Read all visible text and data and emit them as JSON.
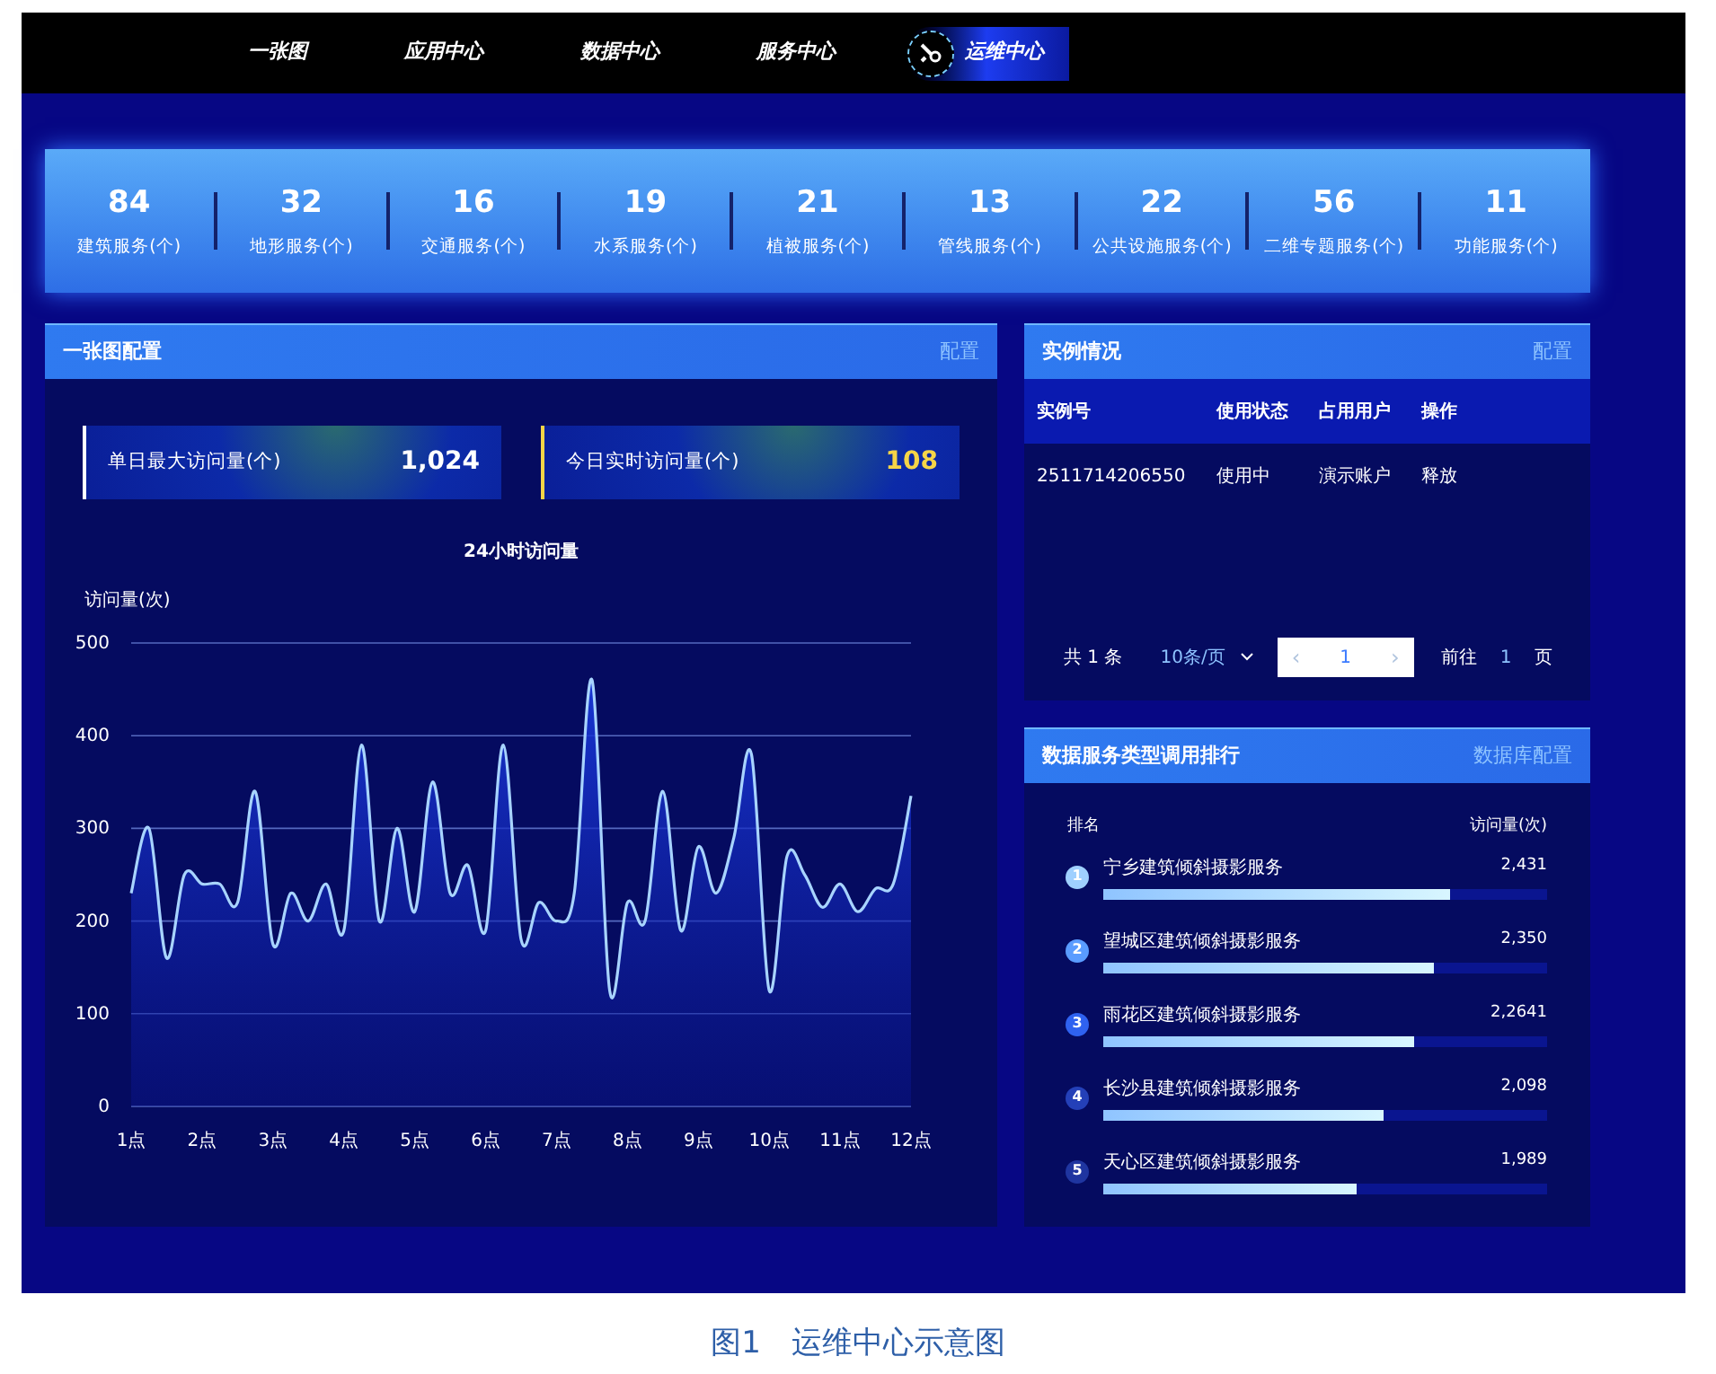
{
  "nav": {
    "tabs": [
      {
        "label": "一张图",
        "selected": false
      },
      {
        "label": "应用中心",
        "selected": false
      },
      {
        "label": "数据中心",
        "selected": false
      },
      {
        "label": "服务中心",
        "selected": false
      },
      {
        "label": "运维中心",
        "selected": true
      }
    ]
  },
  "stats": [
    {
      "value": "84",
      "label": "建筑服务(个)"
    },
    {
      "value": "32",
      "label": "地形服务(个)"
    },
    {
      "value": "16",
      "label": "交通服务(个)"
    },
    {
      "value": "19",
      "label": "水系服务(个)"
    },
    {
      "value": "21",
      "label": "植被服务(个)"
    },
    {
      "value": "13",
      "label": "管线服务(个)"
    },
    {
      "value": "22",
      "label": "公共设施服务(个)"
    },
    {
      "value": "56",
      "label": "二维专题服务(个)"
    },
    {
      "value": "11",
      "label": "功能服务(个)"
    }
  ],
  "map_panel": {
    "title": "一张图配置",
    "action": "配置",
    "kpis": [
      {
        "label": "单日最大访问量(个)",
        "value": "1,024",
        "color": "#ffffff"
      },
      {
        "label": "今日实时访问量(个)",
        "value": "108",
        "color": "#f5d547"
      }
    ],
    "chart_data": {
      "type": "area",
      "title": "24小时访问量",
      "ylabel": "访问量(次)",
      "x": [
        1,
        1.25,
        1.5,
        1.75,
        2,
        2.25,
        2.5,
        2.75,
        3,
        3.25,
        3.5,
        3.75,
        4,
        4.25,
        4.5,
        4.75,
        5,
        5.25,
        5.5,
        5.75,
        6,
        6.25,
        6.5,
        6.75,
        7,
        7.25,
        7.5,
        7.75,
        8,
        8.25,
        8.5,
        8.75,
        9,
        9.25,
        9.5,
        9.75,
        10,
        10.25,
        10.5,
        10.75,
        11,
        11.25,
        11.5,
        11.75,
        12
      ],
      "grid": true,
      "series": [
        {
          "color": "#a8d4ff",
          "values": [
            230,
            300,
            160,
            250,
            240,
            240,
            220,
            340,
            175,
            230,
            200,
            240,
            190,
            390,
            200,
            300,
            210,
            350,
            230,
            260,
            190,
            390,
            180,
            220,
            200,
            230,
            460,
            125,
            220,
            200,
            340,
            190,
            280,
            230,
            290,
            380,
            125,
            270,
            250,
            215,
            240,
            210,
            235,
            240,
            335
          ]
        }
      ],
      "xlim": [
        1,
        12
      ],
      "ylim": [
        0,
        500
      ],
      "xticks": [
        {
          "value": 1,
          "label": "1点"
        },
        {
          "value": 2,
          "label": "2点"
        },
        {
          "value": 3,
          "label": "3点"
        },
        {
          "value": 4,
          "label": "4点"
        },
        {
          "value": 5,
          "label": "5点"
        },
        {
          "value": 6,
          "label": "6点"
        },
        {
          "value": 7,
          "label": "7点"
        },
        {
          "value": 8,
          "label": "8点"
        },
        {
          "value": 9,
          "label": "9点"
        },
        {
          "value": 10,
          "label": "10点"
        },
        {
          "value": 11,
          "label": "11点"
        },
        {
          "value": 12,
          "label": "12点"
        }
      ],
      "yticks": [
        0,
        100,
        200,
        300,
        400,
        500
      ]
    }
  },
  "instances": {
    "title": "实例情况",
    "action": "配置",
    "columns": [
      "实例号",
      "使用状态",
      "占用用户",
      "操作"
    ],
    "rows": [
      [
        "2511714206550",
        "使用中",
        "演示账户",
        "释放"
      ]
    ],
    "pagination": {
      "total": "共 1 条",
      "page_size": "10条/页",
      "prev": "‹",
      "page": "1",
      "next": "›",
      "goto_label": "前往",
      "goto_value": "1",
      "goto_unit": "页"
    }
  },
  "ranking": {
    "title": "数据服务类型调用排行",
    "action": "数据库配置",
    "col_rank": "排名",
    "col_value": "访问量(次)",
    "items": [
      {
        "rank": "1",
        "name": "宁乡建筑倾斜摄影服务",
        "value": "2,431",
        "level": 0.78,
        "color": "#9fd0ff"
      },
      {
        "rank": "2",
        "name": "望城区建筑倾斜摄影服务",
        "value": "2,350",
        "level": 0.745,
        "color": "#5a9cff"
      },
      {
        "rank": "3",
        "name": "雨花区建筑倾斜摄影服务",
        "value": "2,2641",
        "level": 0.7,
        "color": "#2f62f0"
      },
      {
        "rank": "4",
        "name": "长沙县建筑倾斜摄影服务",
        "value": "2,098",
        "level": 0.63,
        "color": "#2440b8"
      },
      {
        "rank": "5",
        "name": "天心区建筑倾斜摄影服务",
        "value": "1,989",
        "level": 0.57,
        "color": "#1f35a0"
      }
    ]
  },
  "caption": "图1　运维中心示意图"
}
